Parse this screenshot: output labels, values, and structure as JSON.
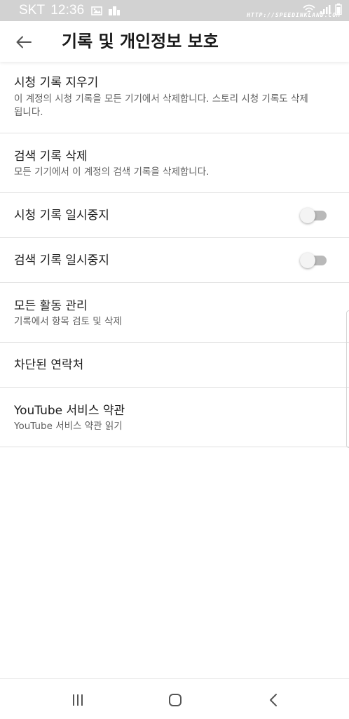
{
  "status_bar": {
    "carrier": "SKT",
    "time": "12:36",
    "watermark": "HTTP://SPEEDINKLAND.COM",
    "icons": [
      "image-icon",
      "buildings-icon",
      "wifi-icon",
      "signal-icon",
      "battery-icon"
    ]
  },
  "header": {
    "back_icon": "back-arrow-icon",
    "title": "기록 및 개인정보 보호"
  },
  "settings": [
    {
      "title": "시청 기록 지우기",
      "subtitle": "이 계정의 시청 기록을 모든 기기에서 삭제합니다. 스토리 시청 기록도 삭제됩니다."
    },
    {
      "title": "검색 기록 삭제",
      "subtitle": "모든 기기에서 이 계정의 검색 기록을 삭제합니다."
    },
    {
      "title": "시청 기록 일시중지",
      "toggle_on": false
    },
    {
      "title": "검색 기록 일시중지",
      "toggle_on": false
    },
    {
      "title": "모든 활동 관리",
      "subtitle": "기록에서 항목 검토 및 삭제"
    },
    {
      "title": "차단된 연락처"
    },
    {
      "title": "YouTube 서비스 약관",
      "subtitle": "YouTube 서비스 약관 읽기"
    }
  ],
  "nav_bar": {
    "buttons": [
      "recent-apps-icon",
      "home-icon",
      "back-icon"
    ]
  },
  "colors": {
    "status_bar_bg": "#d2d2d2",
    "divider": "#e0e0e0",
    "toggle_off_track": "#b9b9b9",
    "toggle_off_thumb": "#f4f4f4",
    "subtitle_text": "#606060"
  }
}
